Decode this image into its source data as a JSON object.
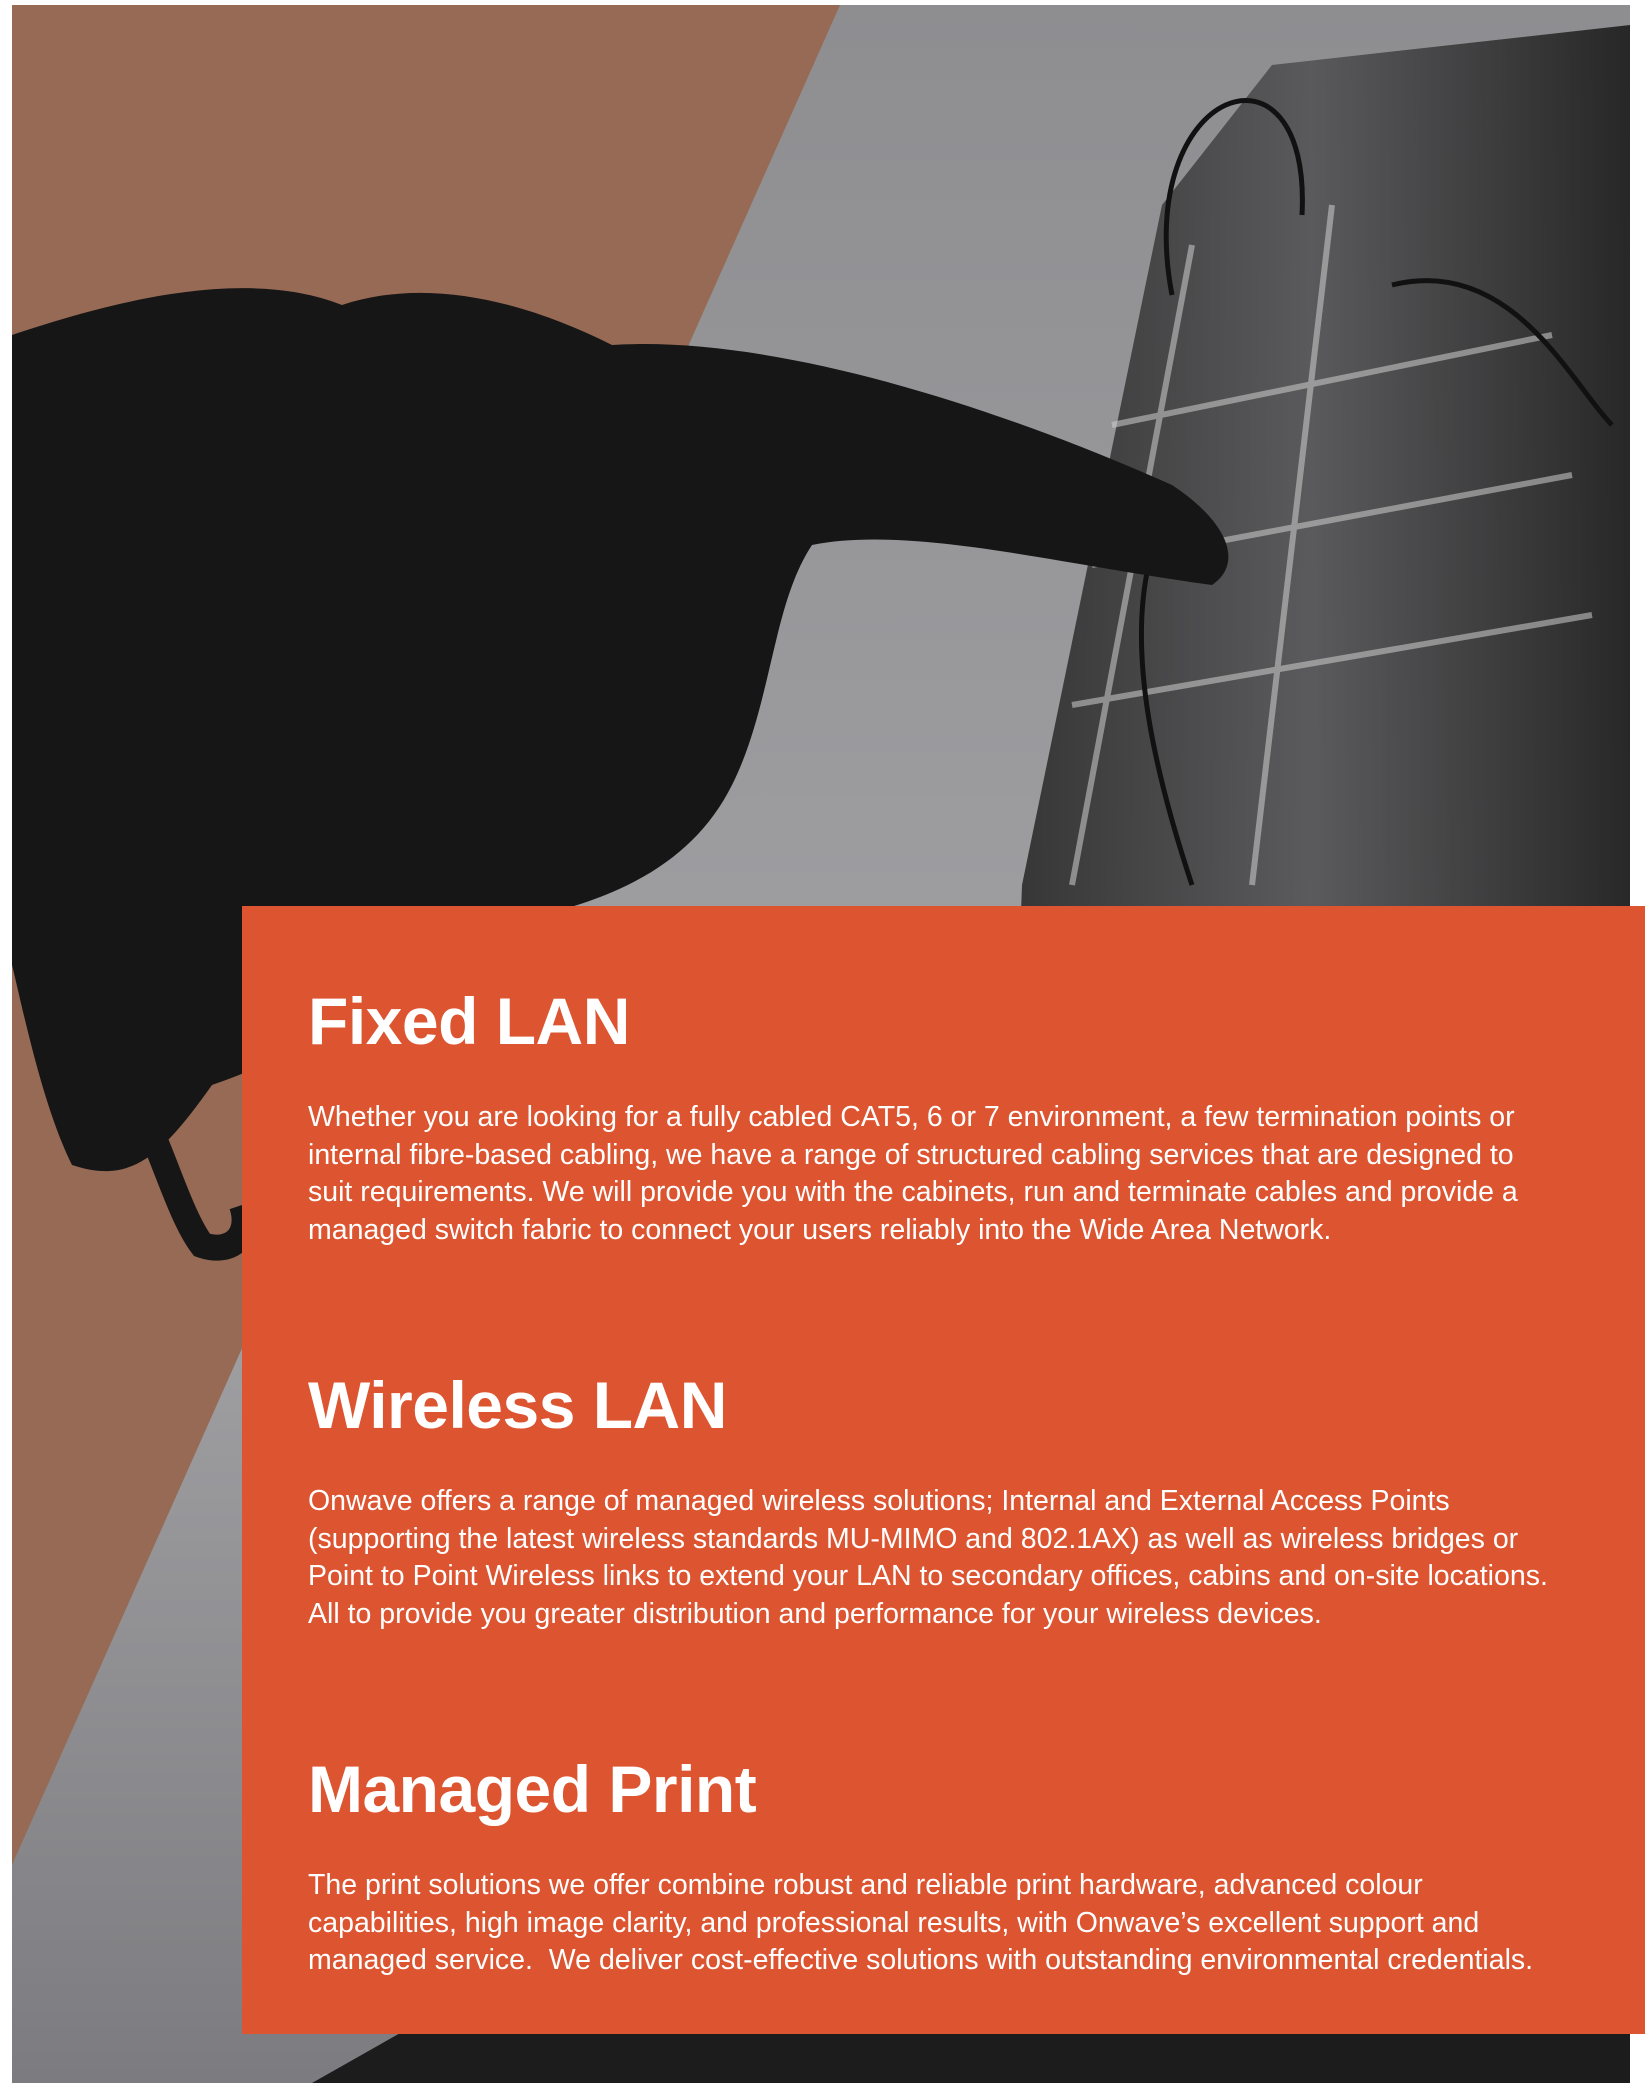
{
  "sections": [
    {
      "heading": "Fixed LAN",
      "body": [
        "Whether you are looking for a fully cabled CAT5, 6 or 7 environment, a few termination points or",
        "internal fibre-based cabling, we have a range of structured cabling services that are designed to",
        "suit requirements. We will provide you with the cabinets, run and terminate cables and provide a",
        "managed switch fabric to connect your users reliably into the Wide Area Network."
      ]
    },
    {
      "heading": "Wireless LAN",
      "body": [
        "Onwave offers a range of managed wireless solutions; Internal and External Access Points",
        "(supporting the latest wireless standards MU-MIMO and 802.1AX) as well as wireless bridges or",
        "Point to Point Wireless links to extend your LAN to secondary offices, cabins and on-site locations.",
        "All to provide you greater distribution and performance for your wireless devices."
      ]
    },
    {
      "heading": "Managed Print",
      "body": [
        "The print solutions we offer combine robust and reliable print hardware, advanced colour",
        "capabilities, high image clarity, and professional results, with Onwave’s excellent support and",
        "managed service.  We deliver cost-effective solutions with outstanding environmental credentials."
      ]
    }
  ],
  "colors": {
    "panel": "#dd5430",
    "copper_band": "#966a54",
    "photo_gray": "#8b8b8e",
    "silhouette": "#161616"
  }
}
